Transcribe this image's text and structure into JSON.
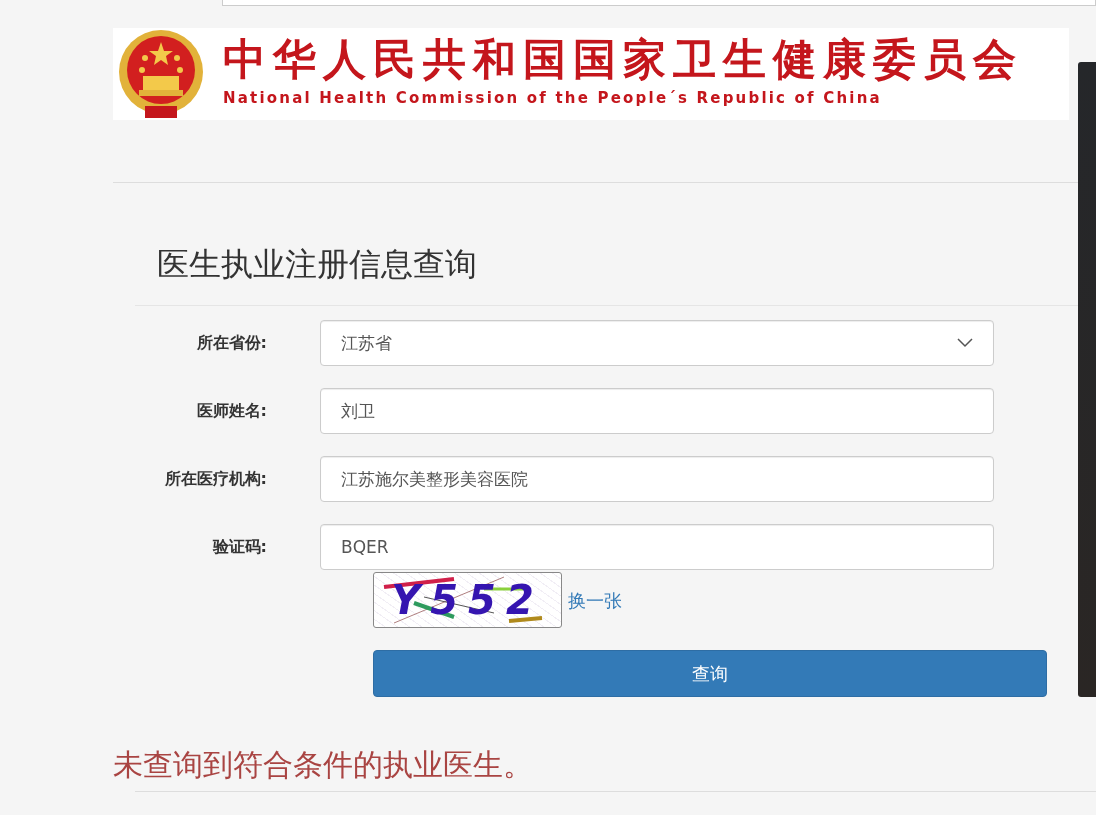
{
  "header": {
    "title_cn": "中华人民共和国国家卫生健康委员会",
    "title_en": "National Health Commission of the People´s Republic of China"
  },
  "page_title": "医生执业注册信息查询",
  "form": {
    "fields": [
      {
        "kind": "select",
        "label": "所在省份:",
        "value": "江苏省"
      },
      {
        "kind": "text",
        "label": "医师姓名:",
        "value": "刘卫"
      },
      {
        "kind": "text",
        "label": "所在医疗机构:",
        "value": "江苏施尔美整形美容医院"
      },
      {
        "kind": "text",
        "label": "验证码:",
        "value": "BQER"
      }
    ],
    "captcha": {
      "text": "Y552",
      "refresh_link": "换一张"
    },
    "submit": "查询"
  },
  "result_message": "未查询到符合条件的执业医生。"
}
